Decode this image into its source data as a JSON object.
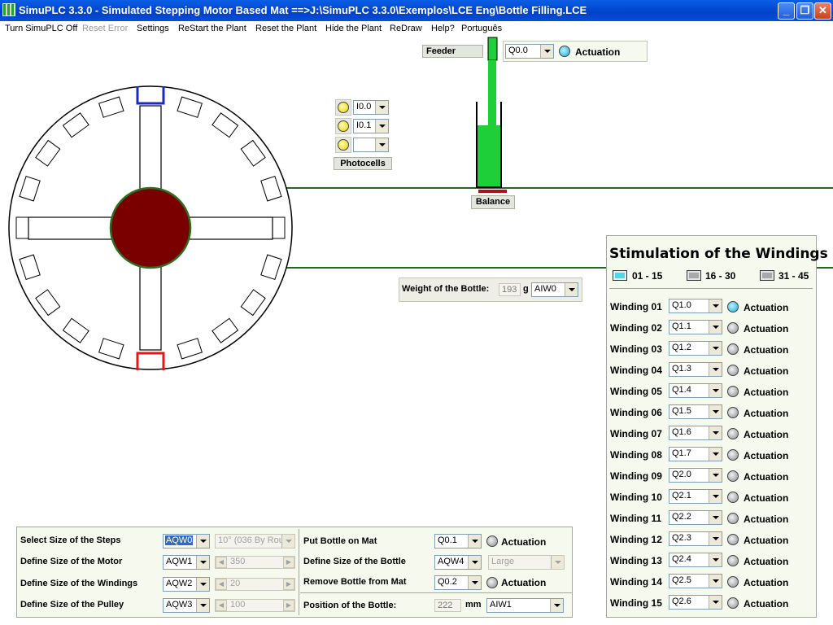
{
  "window": {
    "title": "SimuPLC 3.3.0 - Simulated Stepping Motor Based Mat ==>J:\\SimuPLC 3.3.0\\Exemplos\\LCE Eng\\Bottle Filling.LCE",
    "minimize": "_",
    "maximize": "❐",
    "close": "✕"
  },
  "menu": [
    {
      "label": "Turn SimuPLC Off",
      "disabled": false
    },
    {
      "label": "Reset Error",
      "disabled": true
    },
    {
      "label": "Settings",
      "disabled": false
    },
    {
      "label": "ReStart the Plant",
      "disabled": false
    },
    {
      "label": "Reset the Plant",
      "disabled": false
    },
    {
      "label": "Hide the Plant",
      "disabled": false
    },
    {
      "label": "ReDraw",
      "disabled": false
    },
    {
      "label": "Help?",
      "disabled": false
    },
    {
      "label": "Português",
      "disabled": false
    }
  ],
  "feeder": {
    "label": "Feeder",
    "address": "Q0.0",
    "actuation": "Actuation",
    "led": "blue"
  },
  "photocells": {
    "label": "Photocells",
    "inputs": [
      {
        "address": "I0.0",
        "led": "yellow"
      },
      {
        "address": "I0.1",
        "led": "yellow"
      },
      {
        "address": "",
        "led": "yellow"
      }
    ]
  },
  "balance": {
    "label": "Balance"
  },
  "weight": {
    "label": "Weight of the Bottle:",
    "value": "193",
    "unit": "g",
    "address": "AIW0"
  },
  "windings": {
    "title": "Stimulation of the Windings",
    "pages": [
      {
        "label": "01 - 15",
        "active": true
      },
      {
        "label": "16 - 30",
        "active": false
      },
      {
        "label": "31 - 45",
        "active": false
      }
    ],
    "actuation_label": "Actuation",
    "rows": [
      {
        "label": "Winding 01",
        "address": "Q1.0",
        "active": true
      },
      {
        "label": "Winding 02",
        "address": "Q1.1",
        "active": false
      },
      {
        "label": "Winding 03",
        "address": "Q1.2",
        "active": false
      },
      {
        "label": "Winding 04",
        "address": "Q1.3",
        "active": false
      },
      {
        "label": "Winding 05",
        "address": "Q1.4",
        "active": false
      },
      {
        "label": "Winding 06",
        "address": "Q1.5",
        "active": false
      },
      {
        "label": "Winding 07",
        "address": "Q1.6",
        "active": false
      },
      {
        "label": "Winding 08",
        "address": "Q1.7",
        "active": false
      },
      {
        "label": "Winding 09",
        "address": "Q2.0",
        "active": false
      },
      {
        "label": "Winding 10",
        "address": "Q2.1",
        "active": false
      },
      {
        "label": "Winding 11",
        "address": "Q2.2",
        "active": false
      },
      {
        "label": "Winding 12",
        "address": "Q2.3",
        "active": false
      },
      {
        "label": "Winding 13",
        "address": "Q2.4",
        "active": false
      },
      {
        "label": "Winding 14",
        "address": "Q2.5",
        "active": false
      },
      {
        "label": "Winding 15",
        "address": "Q2.6",
        "active": false
      }
    ]
  },
  "config": {
    "steps": {
      "label": "Select Size of the Steps",
      "address": "AQW0",
      "value": "10° (036 By Rou"
    },
    "motor": {
      "label": "Define Size of the Motor",
      "address": "AQW1",
      "value": "350"
    },
    "windings": {
      "label": "Define Size of the Windings",
      "address": "AQW2",
      "value": "20"
    },
    "pulley": {
      "label": "Define Size of the Pulley",
      "address": "AQW3",
      "value": "100"
    },
    "put_bottle": {
      "label": "Put Bottle on Mat",
      "address": "Q0.1",
      "actuation": "Actuation"
    },
    "bottle_size": {
      "label": "Define Size of the Bottle",
      "address": "AQW4",
      "value": "Large"
    },
    "remove_bottle": {
      "label": "Remove Bottle from Mat",
      "address": "Q0.2",
      "actuation": "Actuation"
    },
    "position": {
      "label": "Position of the Bottle:",
      "value": "222",
      "unit": "mm",
      "address": "AIW1"
    }
  },
  "colors": {
    "rotor": "#7a0000",
    "rotor_ring": "#2e6e1e",
    "belt": "#1e6a1e",
    "liquid": "#1fcf3a",
    "active_coil": "#1a28c8",
    "passive_coil": "#e01818",
    "balance_pad": "#a01818"
  }
}
